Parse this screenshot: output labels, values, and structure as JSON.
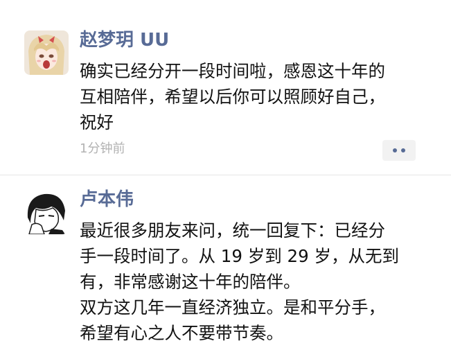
{
  "posts": [
    {
      "username": "赵梦玥 UU",
      "avatar_icon": "anime-girl-avatar",
      "body_lines": [
        "确实已经分开一段时间啦，感恩这十年的",
        "互相陪伴，希望以后你可以照顾好自己，",
        "祝好"
      ],
      "timestamp": "1分钟前",
      "more_icon": "more-dots-icon"
    },
    {
      "username": "卢本伟",
      "avatar_icon": "manga-boy-avatar",
      "body_lines": [
        "最近很多朋友来问，统一回复下：已经分",
        "手一段时间了。从 19 岁到 29 岁，从无到",
        "有，非常感谢这十年的陪伴。",
        "双方这几年一直经济独立。是和平分手，",
        "希望有心之人不要带节奏。"
      ]
    }
  ],
  "colors": {
    "username": "#586b96",
    "body_text": "#111111",
    "timestamp": "#b2b2b2",
    "more_button_bg": "#f2f2f2",
    "divider": "#e6e6e6"
  }
}
